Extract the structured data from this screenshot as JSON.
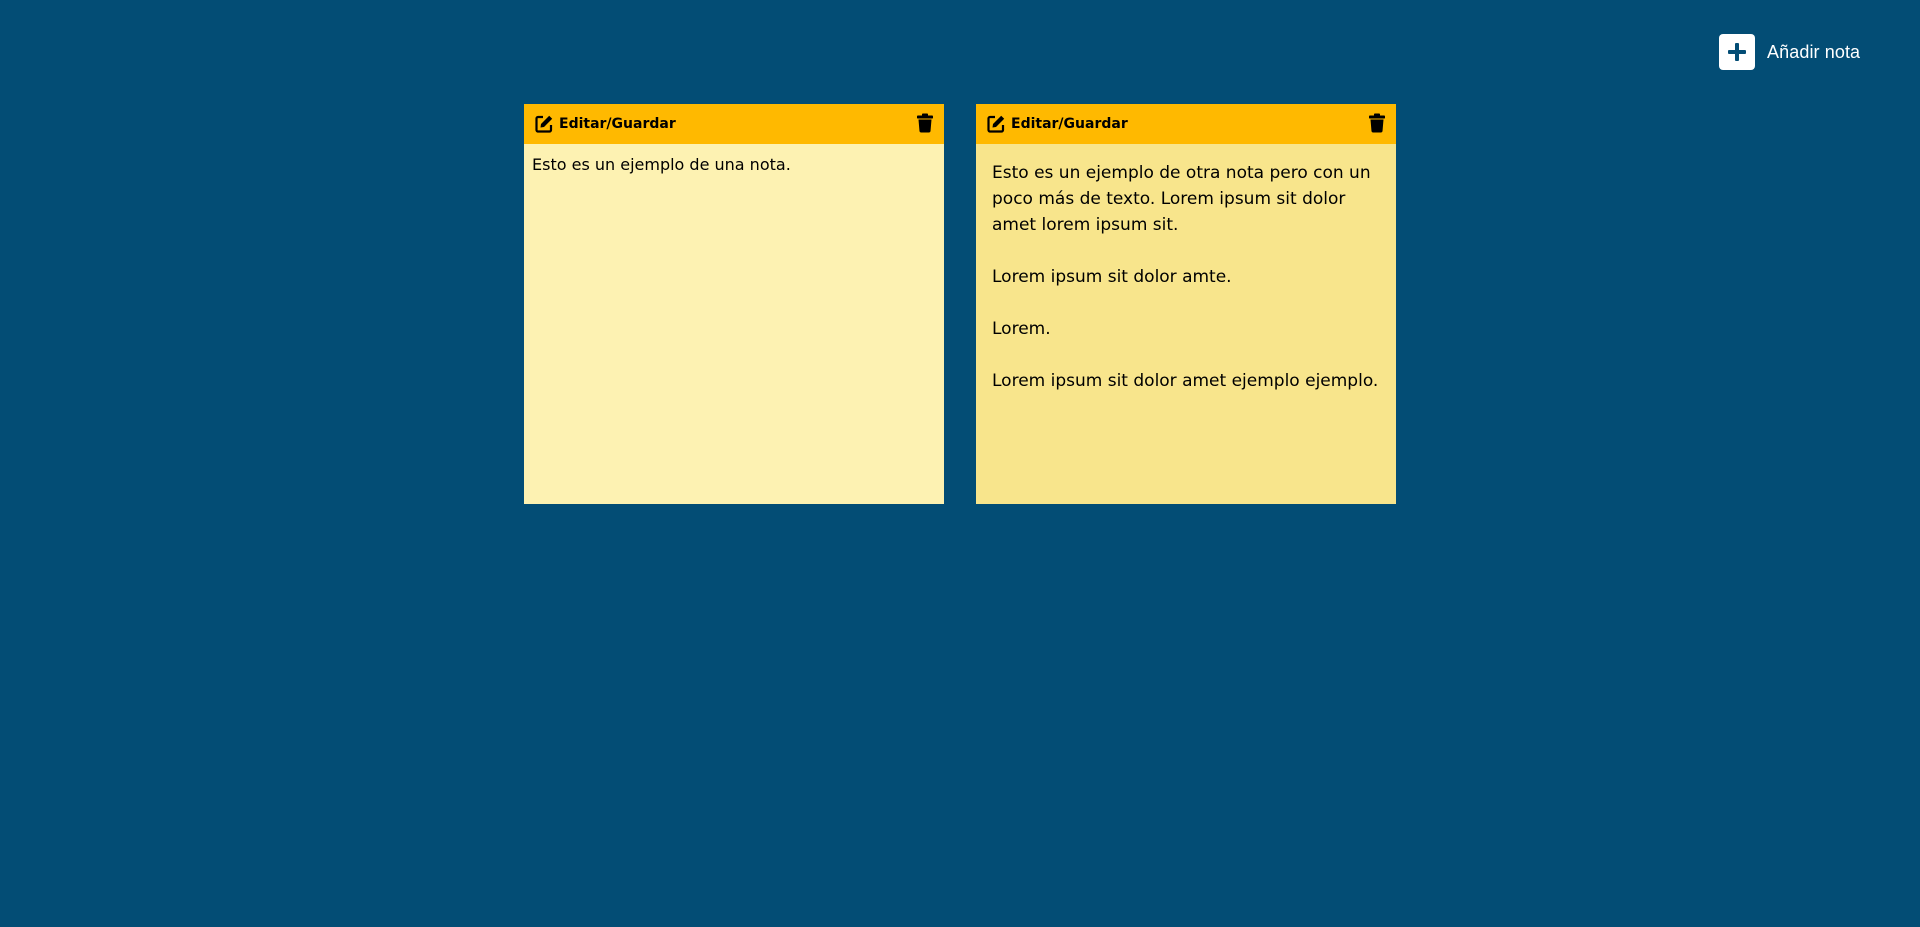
{
  "toolbar": {
    "add_note_label": "Añadir nota"
  },
  "notes": [
    {
      "edit_label": "Editar/Guardar",
      "paragraphs": [
        "Esto es un ejemplo de una nota."
      ]
    },
    {
      "edit_label": "Editar/Guardar",
      "paragraphs": [
        "Esto es un ejemplo de otra nota pero con un poco más de texto. Lorem ipsum sit dolor amet lorem ipsum sit.",
        "Lorem ipsum sit dolor amte.",
        "Lorem.",
        "Lorem ipsum sit dolor amet ejemplo ejemplo."
      ]
    }
  ],
  "colors": {
    "background": "#034d75",
    "note_header": "#ffb900",
    "note_body_1": "#fdf2b2",
    "note_body_2": "#f8e58c"
  },
  "icons": {
    "add": "plus-icon",
    "edit": "edit-icon",
    "delete": "trash-icon"
  }
}
